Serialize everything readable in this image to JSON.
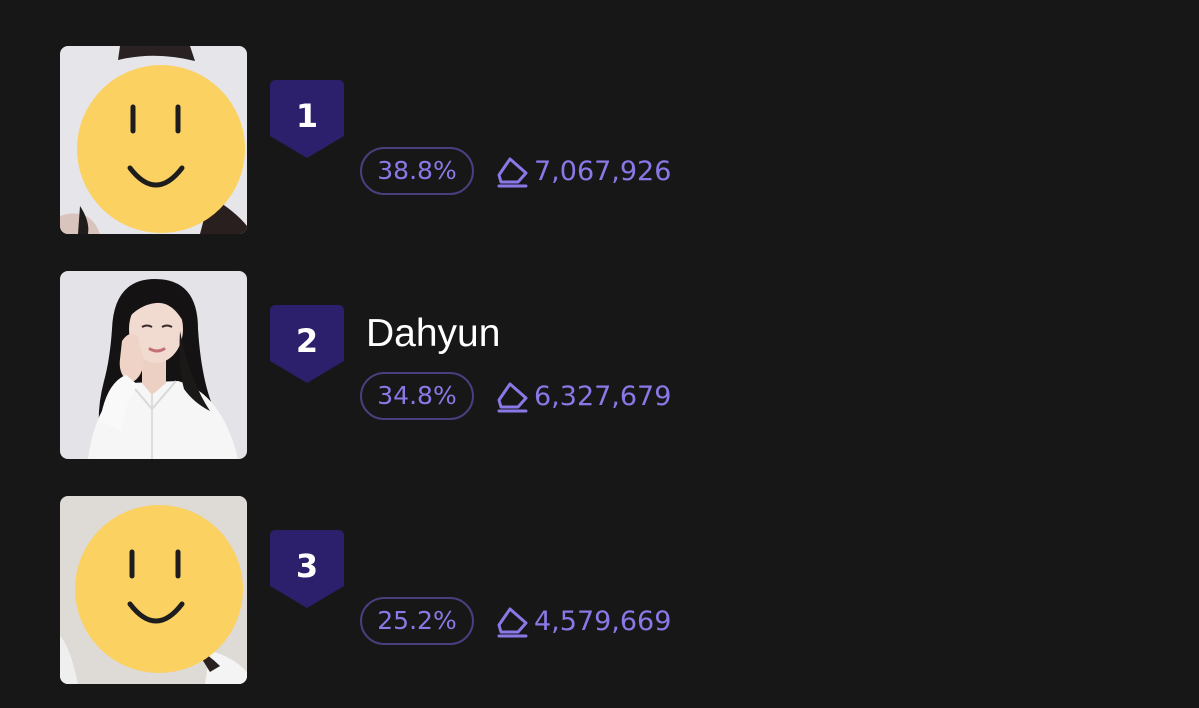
{
  "ranking": [
    {
      "rank": "1",
      "name": "",
      "percent": "38.8%",
      "votes": "7,067,926",
      "photo": "face-covered-by-smiley"
    },
    {
      "rank": "2",
      "name": "Dahyun",
      "percent": "34.8%",
      "votes": "6,327,679",
      "photo": "portrait-photo"
    },
    {
      "rank": "3",
      "name": "",
      "percent": "25.2%",
      "votes": "4,579,669",
      "photo": "face-covered-by-smiley"
    }
  ],
  "icons": {
    "vote": "diamond-vote-icon",
    "badge": "rank-shield-icon"
  },
  "colors": {
    "background": "#171717",
    "badge": "#2c1f6b",
    "accent": "#8a78e6",
    "pill_border": "#4a3f7e",
    "smiley": "#fbd162",
    "text": "#ffffff"
  }
}
